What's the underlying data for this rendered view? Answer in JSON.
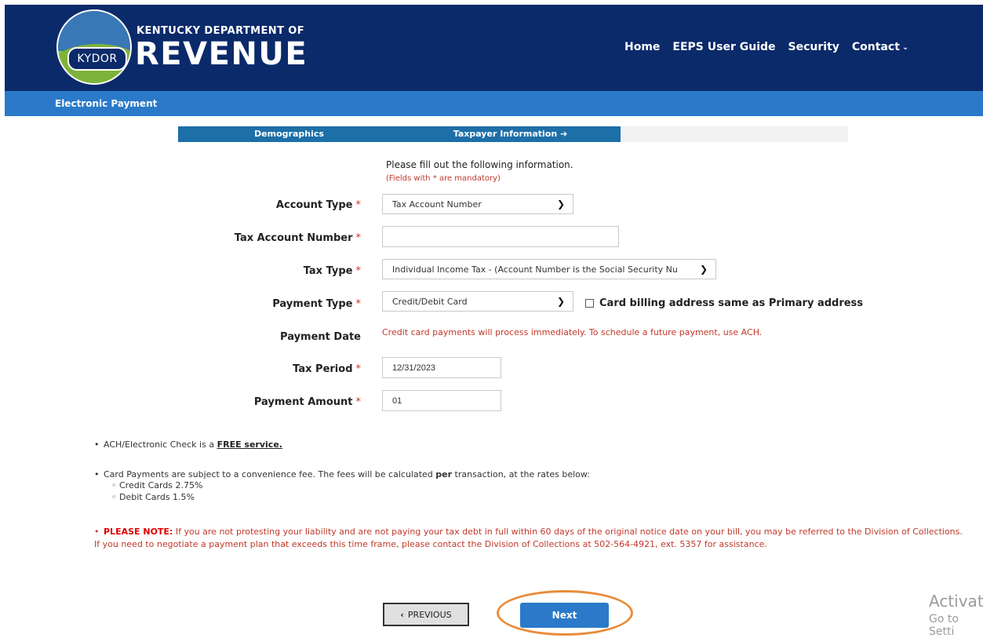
{
  "header": {
    "logo_text": "KYDOR",
    "dept_line": "KENTUCKY DEPARTMENT OF",
    "dept_main": "REVENUE",
    "nav": [
      {
        "label": "Home"
      },
      {
        "label": "EEPS User Guide"
      },
      {
        "label": "Security"
      },
      {
        "label": "Contact"
      }
    ],
    "colors": {
      "primary": "#0b2a6a",
      "accent": "#2a7ac9"
    }
  },
  "subbar": {
    "title": "Electronic Payment"
  },
  "steps": [
    {
      "label": "Demographics"
    },
    {
      "label": "Taxpayer Information ➔"
    }
  ],
  "form": {
    "intro": "Please fill out the following information.",
    "mandatory_note": "(Fields with * are mandatory)",
    "account_type": {
      "label": "Account Type",
      "value": "Tax Account Number"
    },
    "tax_account_number": {
      "label": "Tax Account Number",
      "value": ""
    },
    "tax_type": {
      "label": "Tax Type",
      "value": "Individual Income Tax - (Account Number is the Social Security Nu"
    },
    "payment_type": {
      "label": "Payment Type",
      "value": "Credit/Debit Card"
    },
    "billing_checkbox": {
      "label": "Card billing address same as Primary address",
      "checked": false
    },
    "payment_date": {
      "label": "Payment Date",
      "note": "Credit card payments will process immediately. To schedule a future payment, use ACH."
    },
    "tax_period": {
      "label": "Tax Period",
      "value": "12/31/2023"
    },
    "payment_amount": {
      "label": "Payment Amount",
      "value": "01"
    },
    "required_marker": "*"
  },
  "info": {
    "ach_prefix": "ACH/Electronic Check is a ",
    "ach_free": "FREE service.",
    "card_prefix": "Card Payments are subject to a convenience fee. The fees will be calculated ",
    "card_per": "per",
    "card_suffix": " transaction, at the rates below:",
    "credit_rate": "Credit Cards 2.75%",
    "debit_rate": "Debit Cards 1.5%",
    "note_label": "PLEASE NOTE:",
    "note_text": " If you are not protesting your liability and are not paying your tax debt in full within 60 days of the original notice date on your bill, you may be referred to the Division of Collections. If you need to negotiate a payment plan that exceeds this time frame, please contact the Division of Collections at 502-564-4921, ext. 5357 for assistance."
  },
  "buttons": {
    "previous": "PREVIOUS",
    "next": "Next"
  },
  "watermark": {
    "line1": "Activate",
    "line2": "Go to Setti"
  }
}
